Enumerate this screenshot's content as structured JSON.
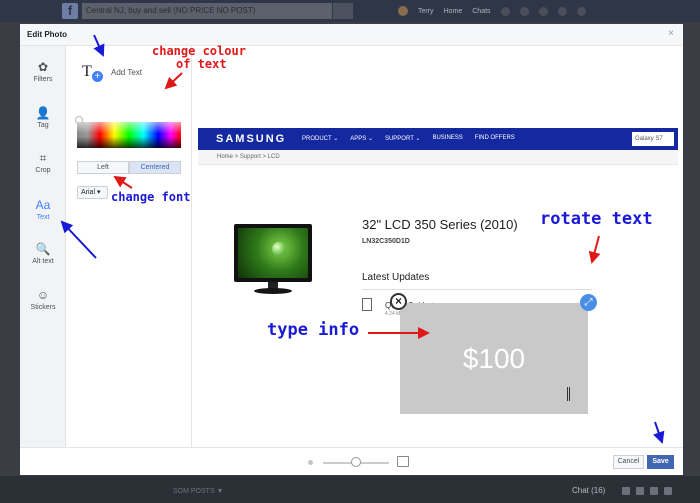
{
  "background": {
    "search_text": "Central NJ, buy and sell (NO PRICE NO POST)",
    "user_name": "Terry",
    "nav_home": "Home",
    "nav_chats": "Chats",
    "bottom_text": "SOM POSTS ▼",
    "chat_label": "Chat (16)"
  },
  "modal": {
    "title": "Edit Photo",
    "close_icon": "×"
  },
  "rail": {
    "items": [
      {
        "label": "Filters",
        "icon": "filters-icon",
        "glyph": "✿"
      },
      {
        "label": "Tag",
        "icon": "tag-person-icon",
        "glyph": "👤"
      },
      {
        "label": "Crop",
        "icon": "crop-icon",
        "glyph": "⌗"
      },
      {
        "label": "Text",
        "icon": "text-icon",
        "glyph": "Aa"
      },
      {
        "label": "Alt text",
        "icon": "search-icon",
        "glyph": "🔍"
      },
      {
        "label": "Stickers",
        "icon": "sticker-icon",
        "glyph": "☺"
      }
    ],
    "active": "Text"
  },
  "panel": {
    "add_text_label": "Add Text",
    "align_left": "Left",
    "align_centered": "Centered",
    "align_selected": "Centered",
    "font_value": "Arial"
  },
  "canvas": {
    "brand": "SAMSUNG",
    "menu": [
      "PRODUCT ⌄",
      "APPS ⌄",
      "SUPPORT ⌄",
      "BUSINESS",
      "FIND OFFERS"
    ],
    "search_placeholder": "Galaxy S7",
    "breadcrumb": "Home > Support > LCD",
    "product_title": "32\" LCD 350 Series (2010)",
    "product_model": "LN32C350D1D",
    "updates_title": "Latest Updates",
    "doc_name": "Quick Guide  ⭳",
    "doc_meta": "4.24 MB pdf",
    "text_box_value": "$100"
  },
  "footer": {
    "cancel_label": "Cancel",
    "save_label": "Save"
  },
  "annotations": {
    "change_colour": "change colour",
    "of_text": "of text",
    "change_font": "change font",
    "rotate_text": "rotate text",
    "type_info": "type info"
  },
  "colors": {
    "accent": "#4080ff",
    "save_button": "#4267b2",
    "samsung_nav": "#1428a0",
    "annotation_blue": "#1a1ad6",
    "annotation_red": "#e01818"
  }
}
